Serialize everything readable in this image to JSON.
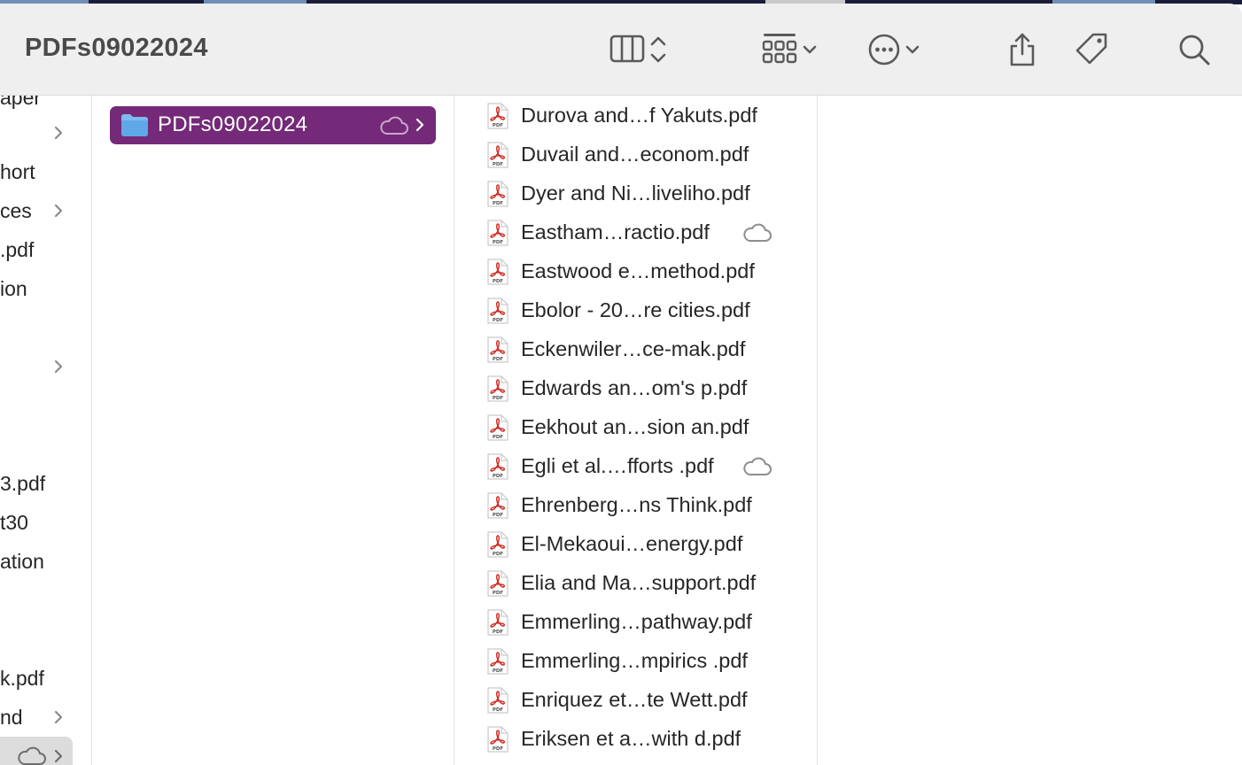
{
  "window": {
    "title": "PDFs09022024"
  },
  "colors": {
    "selection": "#742a78",
    "toolbar_bg": "#efefef",
    "pdf_red": "#d0251b",
    "folder_blue": "#5fa8e8"
  },
  "toolbar": {
    "buttons": [
      {
        "name": "column-view-button",
        "icon": "columns-icon"
      },
      {
        "name": "group-button",
        "icon": "grid-icon"
      },
      {
        "name": "more-actions-button",
        "icon": "ellipsis-icon"
      },
      {
        "name": "share-button",
        "icon": "share-icon"
      },
      {
        "name": "tag-button",
        "icon": "tag-icon"
      },
      {
        "name": "search-button",
        "icon": "search-icon"
      }
    ]
  },
  "sidebar": {
    "items": [
      {
        "label": "aper",
        "chevron": false
      },
      {
        "label": "",
        "chevron": true
      },
      {
        "label": "hort",
        "chevron": false
      },
      {
        "label": "ces",
        "chevron": true
      },
      {
        "label": ".pdf",
        "chevron": false
      },
      {
        "label": "ion",
        "chevron": false
      },
      {
        "label": "",
        "chevron": false
      },
      {
        "label": "",
        "chevron": true
      },
      {
        "label": "",
        "chevron": false
      },
      {
        "label": "",
        "chevron": false
      },
      {
        "label": "3.pdf",
        "chevron": false
      },
      {
        "label": "t30",
        "chevron": false
      },
      {
        "label": "ation",
        "chevron": false
      },
      {
        "label": "",
        "chevron": false
      },
      {
        "label": "",
        "chevron": false
      },
      {
        "label": "k.pdf",
        "chevron": false
      },
      {
        "label": "nd",
        "chevron": true
      },
      {
        "label": "",
        "chevron": true,
        "selected": true,
        "cloud": true
      }
    ]
  },
  "folders": {
    "selected": {
      "name": "PDFs09022024",
      "icon": "folder-icon",
      "status_icon": "cloud-icon"
    }
  },
  "files": [
    {
      "name": "Durova and…f Yakuts.pdf",
      "cloud": false
    },
    {
      "name": "Duvail and…econom.pdf",
      "cloud": false
    },
    {
      "name": "Dyer and Ni…liveliho.pdf",
      "cloud": false
    },
    {
      "name": "Eastham…ractio.pdf",
      "cloud": true
    },
    {
      "name": "Eastwood e…method.pdf",
      "cloud": false
    },
    {
      "name": "Ebolor - 20…re cities.pdf",
      "cloud": false
    },
    {
      "name": "Eckenwiler…ce-mak.pdf",
      "cloud": false
    },
    {
      "name": "Edwards an…om's p.pdf",
      "cloud": false
    },
    {
      "name": "Eekhout an…sion an.pdf",
      "cloud": false
    },
    {
      "name": "Egli et al.…fforts .pdf",
      "cloud": true
    },
    {
      "name": "Ehrenberg…ns Think.pdf",
      "cloud": false
    },
    {
      "name": "El-Mekaoui…energy.pdf",
      "cloud": false
    },
    {
      "name": "Elia and Ma…support.pdf",
      "cloud": false
    },
    {
      "name": "Emmerling…pathway.pdf",
      "cloud": false
    },
    {
      "name": "Emmerling…mpirics .pdf",
      "cloud": false
    },
    {
      "name": "Enriquez et…te Wett.pdf",
      "cloud": false
    },
    {
      "name": "Eriksen et a…with d.pdf",
      "cloud": false
    }
  ]
}
